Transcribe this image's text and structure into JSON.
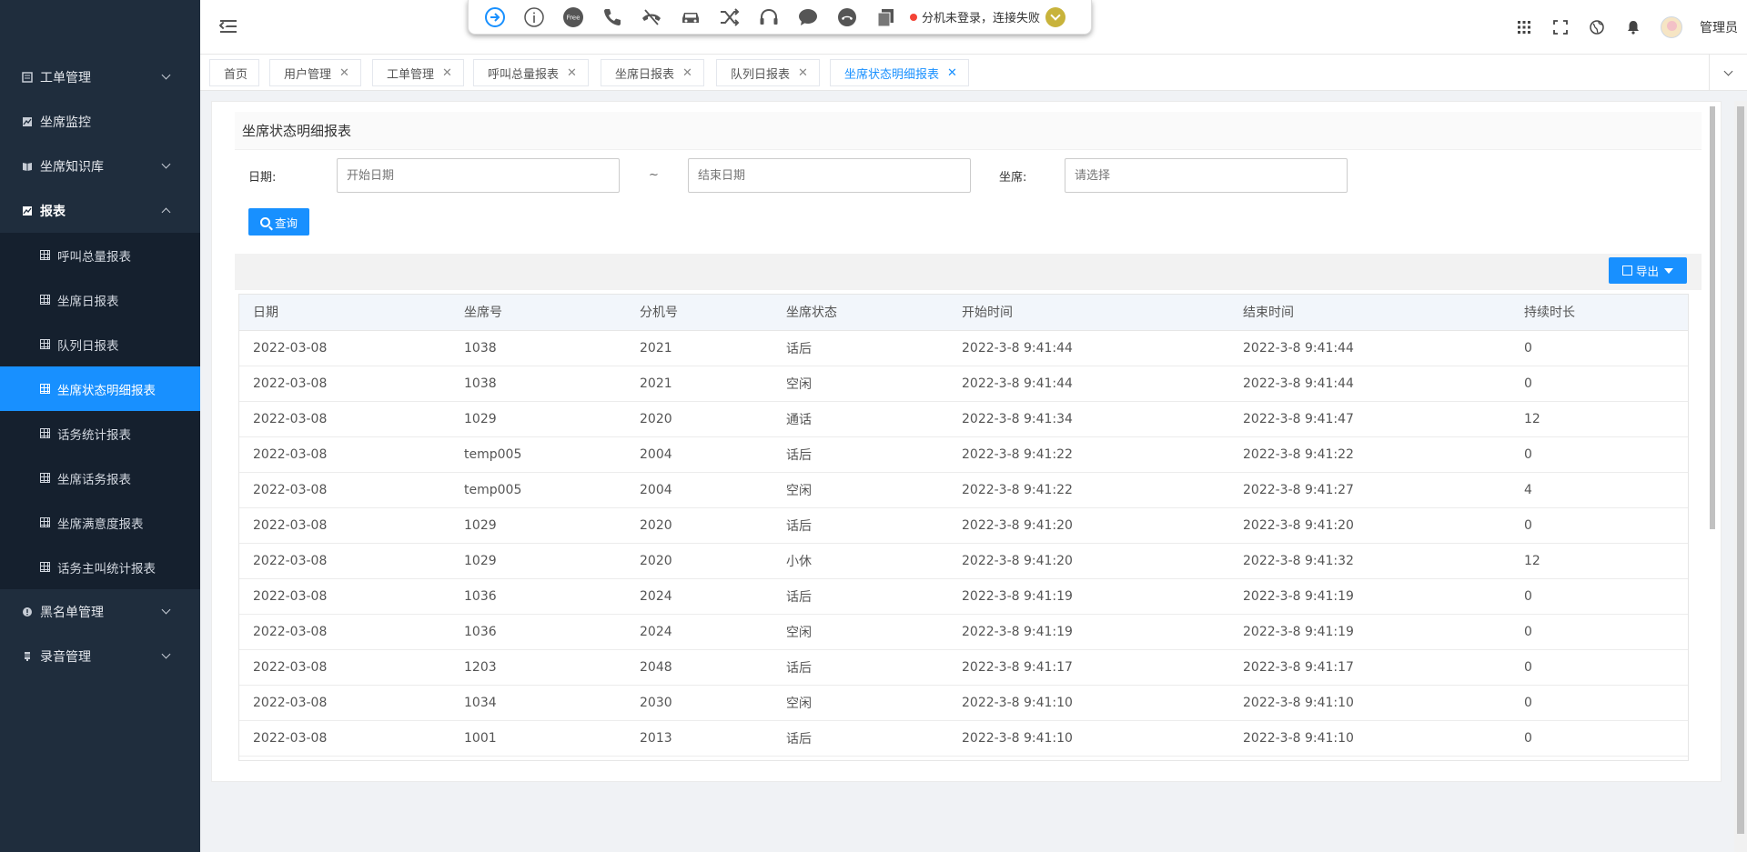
{
  "sidebar": {
    "items": [
      {
        "label": "工单管理"
      },
      {
        "label": "坐席监控"
      },
      {
        "label": "坐席知识库"
      },
      {
        "label": "报表"
      },
      {
        "label": "黑名单管理"
      },
      {
        "label": "录音管理"
      }
    ],
    "report_sub": [
      {
        "label": "呼叫总量报表"
      },
      {
        "label": "坐席日报表"
      },
      {
        "label": "队列日报表"
      },
      {
        "label": "坐席状态明细报表"
      },
      {
        "label": "话务统计报表"
      },
      {
        "label": "坐席话务报表"
      },
      {
        "label": "坐席满意度报表"
      },
      {
        "label": "话务主叫统计报表"
      }
    ]
  },
  "phonebar": {
    "free_label": "Free",
    "status_text": "分机未登录，连接失败"
  },
  "header": {
    "username": "管理员"
  },
  "tabs": [
    {
      "label": "首页"
    },
    {
      "label": "用户管理"
    },
    {
      "label": "工单管理"
    },
    {
      "label": "呼叫总量报表"
    },
    {
      "label": "坐席日报表"
    },
    {
      "label": "队列日报表"
    },
    {
      "label": "坐席状态明细报表"
    }
  ],
  "page": {
    "title": "坐席状态明细报表",
    "date_label": "日期:",
    "start_placeholder": "开始日期",
    "tilde": "~",
    "end_placeholder": "结束日期",
    "agent_label": "坐席:",
    "agent_placeholder": "请选择",
    "query_label": "查询",
    "export_label": "导出"
  },
  "table": {
    "headers": [
      "日期",
      "坐席号",
      "分机号",
      "坐席状态",
      "开始时间",
      "结束时间",
      "持续时长"
    ],
    "rows": [
      [
        "2022-03-08",
        "1038",
        "2021",
        "话后",
        "2022-3-8 9:41:44",
        "2022-3-8 9:41:44",
        "0"
      ],
      [
        "2022-03-08",
        "1038",
        "2021",
        "空闲",
        "2022-3-8 9:41:44",
        "2022-3-8 9:41:44",
        "0"
      ],
      [
        "2022-03-08",
        "1029",
        "2020",
        "通话",
        "2022-3-8 9:41:34",
        "2022-3-8 9:41:47",
        "12"
      ],
      [
        "2022-03-08",
        "temp005",
        "2004",
        "话后",
        "2022-3-8 9:41:22",
        "2022-3-8 9:41:22",
        "0"
      ],
      [
        "2022-03-08",
        "temp005",
        "2004",
        "空闲",
        "2022-3-8 9:41:22",
        "2022-3-8 9:41:27",
        "4"
      ],
      [
        "2022-03-08",
        "1029",
        "2020",
        "话后",
        "2022-3-8 9:41:20",
        "2022-3-8 9:41:20",
        "0"
      ],
      [
        "2022-03-08",
        "1029",
        "2020",
        "小休",
        "2022-3-8 9:41:20",
        "2022-3-8 9:41:32",
        "12"
      ],
      [
        "2022-03-08",
        "1036",
        "2024",
        "话后",
        "2022-3-8 9:41:19",
        "2022-3-8 9:41:19",
        "0"
      ],
      [
        "2022-03-08",
        "1036",
        "2024",
        "空闲",
        "2022-3-8 9:41:19",
        "2022-3-8 9:41:19",
        "0"
      ],
      [
        "2022-03-08",
        "1203",
        "2048",
        "话后",
        "2022-3-8 9:41:17",
        "2022-3-8 9:41:17",
        "0"
      ],
      [
        "2022-03-08",
        "1034",
        "2030",
        "空闲",
        "2022-3-8 9:41:10",
        "2022-3-8 9:41:10",
        "0"
      ],
      [
        "2022-03-08",
        "1001",
        "2013",
        "话后",
        "2022-3-8 9:41:10",
        "2022-3-8 9:41:10",
        "0"
      ]
    ]
  },
  "colors": {
    "sidebar_bg": "#1f2d3d",
    "submenu_bg": "#15202e",
    "accent": "#1890ff",
    "status_dot": "#f44336",
    "status_dropdown": "#c8b33b"
  }
}
